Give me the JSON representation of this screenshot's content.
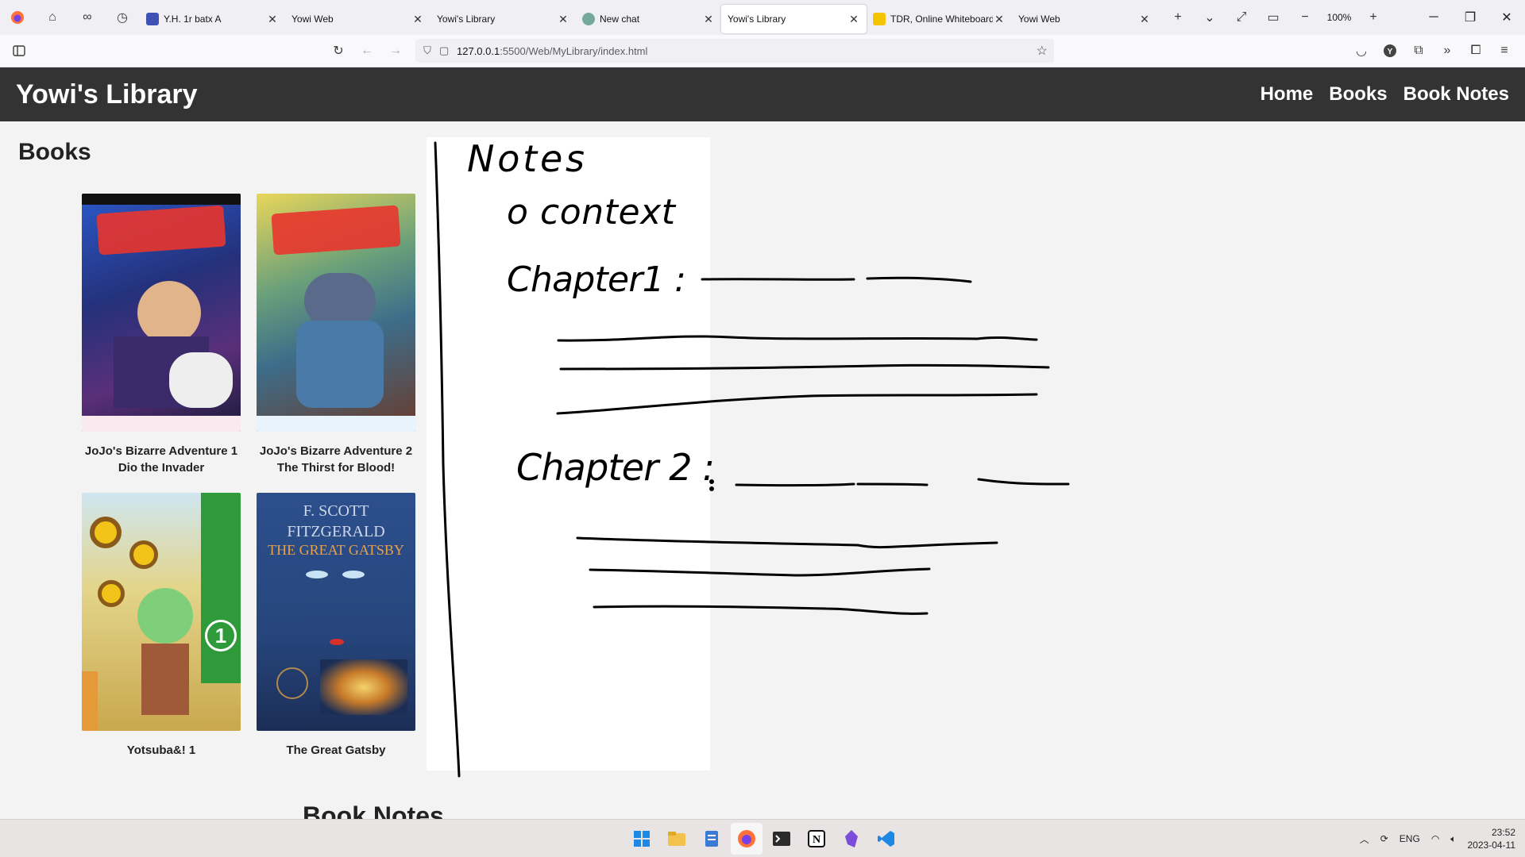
{
  "browser": {
    "tabs": [
      {
        "title": "Y.H. 1r batx A",
        "favicon_color": "#3f51b5",
        "active": false
      },
      {
        "title": "Yowi Web",
        "favicon_color": "",
        "active": false
      },
      {
        "title": "Yowi's Library",
        "favicon_color": "",
        "active": false
      },
      {
        "title": "New chat",
        "favicon_color": "#74aa9c",
        "active": false
      },
      {
        "title": "Yowi's Library",
        "favicon_color": "",
        "active": true
      },
      {
        "title": "TDR, Online Whiteboard",
        "favicon_color": "#f5c400",
        "active": false
      },
      {
        "title": "Yowi Web",
        "favicon_color": "",
        "active": false
      }
    ],
    "zoom": "100%",
    "url_host": "127.0.0.1",
    "url_path": ":5500/Web/MyLibrary/index.html"
  },
  "site": {
    "title": "Yowi's Library",
    "nav": [
      "Home",
      "Books",
      "Book Notes"
    ],
    "books_heading": "Books",
    "notes_heading": "Book Notes",
    "books": [
      {
        "title_line1": "JoJo's Bizarre Adventure 1",
        "title_line2": "Dio the Invader",
        "cover_color": "#2a3f8f"
      },
      {
        "title_line1": "JoJo's Bizarre Adventure 2",
        "title_line2": "The Thirst for Blood!",
        "cover_color": "#4a7a5a"
      },
      {
        "title_line1": "Yotsuba&! 1",
        "title_line2": "",
        "cover_color": "#d8c46a"
      },
      {
        "title_line1": "The Great Gatsby",
        "title_line2": "",
        "cover_color": "#2f4f86"
      }
    ],
    "gatsby_cover": {
      "author_1": "F. SCOTT",
      "author_2": "FITZGERALD",
      "title": "THE GREAT GATSBY"
    }
  },
  "whiteboard": {
    "heading": "Notes",
    "bullet": "o context",
    "chapter1": "Chapter1 :",
    "chapter2": "Chapter 2 :"
  },
  "taskbar": {
    "lang": "ENG",
    "time": "23:52",
    "date": "2023-04-11"
  }
}
